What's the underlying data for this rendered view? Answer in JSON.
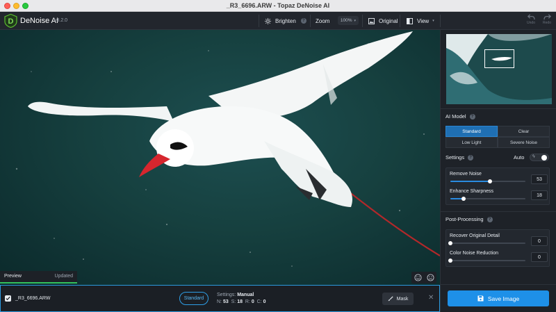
{
  "window": {
    "title": "_R3_6696.ARW - Topaz DeNoise AI"
  },
  "app": {
    "name": "DeNoise AI",
    "version": "v3.2.0"
  },
  "toolbar": {
    "brighten_label": "Brighten",
    "zoom_label": "Zoom",
    "zoom_value": "100%",
    "original_label": "Original",
    "view_label": "View",
    "undo_label": "Undo",
    "redo_label": "Redo"
  },
  "preview": {
    "label": "Preview",
    "status": "Updated",
    "progress": 1.0
  },
  "bottom_bar": {
    "filename": "_R3_6696.ARW",
    "checked": true,
    "model": "Standard",
    "settings_label": "Settings:",
    "settings_value": "Manual",
    "n_label": "N:",
    "n_value": "53",
    "s_label": "S:",
    "s_value": "18",
    "r_label": "R:",
    "r_value": "0",
    "c_label": "C:",
    "c_value": "0",
    "mask_label": "Mask"
  },
  "panel": {
    "ai_model_title": "AI Model",
    "models": [
      "Standard",
      "Clear",
      "Low Light",
      "Severe Noise"
    ],
    "active_model": "Standard",
    "settings_title": "Settings",
    "auto_label": "Auto",
    "auto_enabled": true,
    "remove_noise": {
      "label": "Remove Noise",
      "value": "53",
      "fraction": 0.53
    },
    "enhance_sharpness": {
      "label": "Enhance Sharpness",
      "value": "18",
      "fraction": 0.18
    },
    "post_processing_title": "Post-Processing",
    "recover_detail": {
      "label": "Recover Original Detail",
      "value": "0",
      "fraction": 0
    },
    "color_noise": {
      "label": "Color Noise Reduction",
      "value": "0",
      "fraction": 0
    },
    "save_label": "Save Image"
  },
  "colors": {
    "accent": "#1e90e8",
    "active_model": "#1f6fb3",
    "progress": "#33c25d"
  }
}
